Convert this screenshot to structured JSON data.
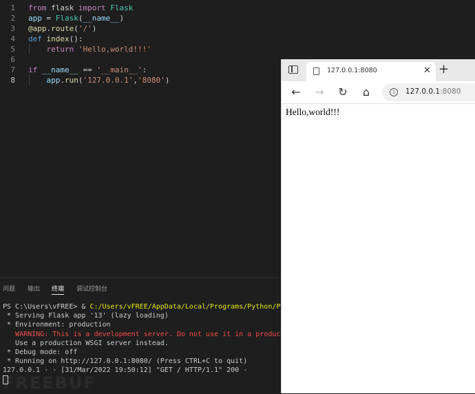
{
  "editor": {
    "lines": [
      {
        "num": "1",
        "tokens": [
          {
            "t": "from",
            "c": "kw"
          },
          {
            "t": " flask ",
            "c": "plain"
          },
          {
            "t": "import",
            "c": "kw"
          },
          {
            "t": " Flask",
            "c": "cls"
          }
        ]
      },
      {
        "num": "2",
        "tokens": [
          {
            "t": "app",
            "c": "var"
          },
          {
            "t": " = ",
            "c": "plain"
          },
          {
            "t": "Flask",
            "c": "cls"
          },
          {
            "t": "(",
            "c": "plain"
          },
          {
            "t": "__name__",
            "c": "var"
          },
          {
            "t": ")",
            "c": "plain"
          }
        ]
      },
      {
        "num": "3",
        "tokens": [
          {
            "t": "@app",
            "c": "fn"
          },
          {
            "t": ".",
            "c": "plain"
          },
          {
            "t": "route",
            "c": "fn"
          },
          {
            "t": "(",
            "c": "plain"
          },
          {
            "t": "'/'",
            "c": "str"
          },
          {
            "t": ")",
            "c": "plain"
          }
        ]
      },
      {
        "num": "4",
        "tokens": [
          {
            "t": "def",
            "c": "kw2"
          },
          {
            "t": " ",
            "c": "plain"
          },
          {
            "t": "index",
            "c": "fn"
          },
          {
            "t": "():",
            "c": "plain"
          }
        ]
      },
      {
        "num": "5",
        "tokens": [
          {
            "t": "    ",
            "c": "plain"
          },
          {
            "t": "return",
            "c": "kw"
          },
          {
            "t": " ",
            "c": "plain"
          },
          {
            "t": "'Hello,world!!!'",
            "c": "str"
          }
        ]
      },
      {
        "num": "6",
        "tokens": []
      },
      {
        "num": "7",
        "tokens": [
          {
            "t": "if",
            "c": "kw"
          },
          {
            "t": " ",
            "c": "plain"
          },
          {
            "t": "__name__",
            "c": "var"
          },
          {
            "t": " == ",
            "c": "plain"
          },
          {
            "t": "'__main__'",
            "c": "str"
          },
          {
            "t": ":",
            "c": "plain"
          }
        ]
      },
      {
        "num": "8",
        "tokens": [
          {
            "t": "    ",
            "c": "plain"
          },
          {
            "t": "app",
            "c": "var"
          },
          {
            "t": ".",
            "c": "plain"
          },
          {
            "t": "run",
            "c": "fn"
          },
          {
            "t": "(",
            "c": "plain"
          },
          {
            "t": "'127.0.0.1'",
            "c": "str"
          },
          {
            "t": ",",
            "c": "plain"
          },
          {
            "t": "'8080'",
            "c": "str"
          },
          {
            "t": ")",
            "c": "plain"
          }
        ]
      }
    ],
    "active_line": "8"
  },
  "panel": {
    "tabs": [
      {
        "label": "问题",
        "active": false
      },
      {
        "label": "输出",
        "active": false
      },
      {
        "label": "终端",
        "active": true
      },
      {
        "label": "调试控制台",
        "active": false
      }
    ]
  },
  "terminal": {
    "lines": [
      {
        "parts": [
          {
            "t": "PS C:\\Users\\vFREE> & ",
            "c": ""
          },
          {
            "t": "C:/Users/vFREE/AppData/Local/Programs/Python/Pyth",
            "c": "tyellow"
          }
        ]
      },
      {
        "parts": [
          {
            "t": " * Serving Flask app '13' (lazy loading)",
            "c": ""
          }
        ]
      },
      {
        "parts": [
          {
            "t": " * Environment: production",
            "c": ""
          }
        ]
      },
      {
        "parts": [
          {
            "t": "   WARNING: This is a development server. Do not use it in a productio",
            "c": "tred"
          }
        ]
      },
      {
        "parts": [
          {
            "t": "   Use a production WSGI server instead.",
            "c": ""
          }
        ]
      },
      {
        "parts": [
          {
            "t": " * Debug mode: off",
            "c": ""
          }
        ]
      },
      {
        "parts": [
          {
            "t": " * Running on http://127.0.0.1:8080/ (Press CTRL+C to quit)",
            "c": ""
          }
        ]
      },
      {
        "parts": [
          {
            "t": "127.0.0.1 - - [31/Mar/2022 19:50:12] \"GET / HTTP/1.1\" 200 -",
            "c": ""
          }
        ]
      }
    ]
  },
  "browser": {
    "tab_title": "127.0.0.1:8080",
    "tab_close": "✕",
    "new_tab": "+",
    "nav": {
      "back": "←",
      "forward": "→",
      "reload": "↻",
      "home": "⌂"
    },
    "info_glyph": "i",
    "url_host": "127.0.0.1",
    "url_port": ":8080",
    "page_text": "Hello,world!!!"
  },
  "watermark": "FREEBUF"
}
